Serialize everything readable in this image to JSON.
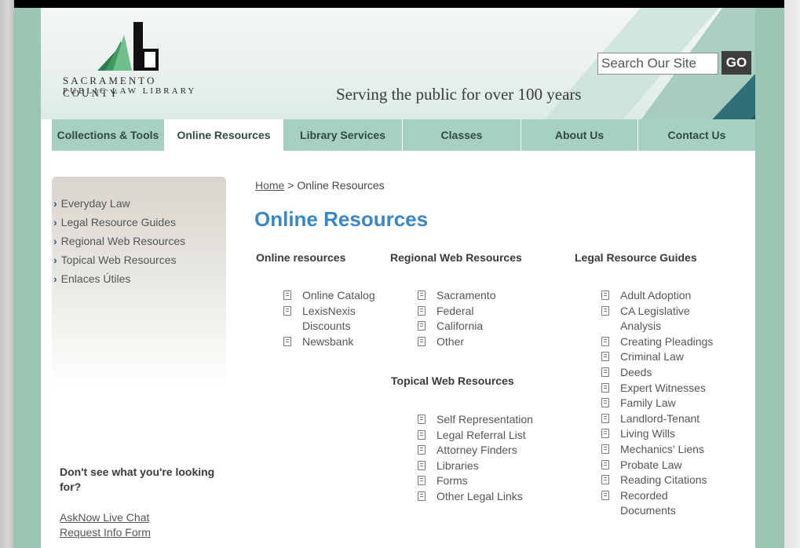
{
  "header": {
    "logo_line1": "SACRAMENTO COUNTY",
    "logo_line2": "PUBLIC LAW LIBRARY",
    "tagline": "Serving the public for over 100 years",
    "search_placeholder": "Search Our Site",
    "go_label": "GO"
  },
  "nav": {
    "tabs": [
      {
        "label": "Collections & Tools"
      },
      {
        "label": "Online Resources"
      },
      {
        "label": "Library Services"
      },
      {
        "label": "Classes"
      },
      {
        "label": "About Us"
      },
      {
        "label": "Contact Us"
      }
    ],
    "active_index": 1
  },
  "sidebar": {
    "items": [
      {
        "label": "Everyday Law"
      },
      {
        "label": "Legal Resource Guides"
      },
      {
        "label": "Regional Web Resources"
      },
      {
        "label": "Topical Web Resources"
      },
      {
        "label": "Enlaces Útiles"
      }
    ],
    "help_heading": "Don't see what you're looking for?",
    "help_links": [
      "AskNow Live Chat",
      "Request Info Form"
    ]
  },
  "breadcrumb": {
    "home": "Home",
    "separator": ">",
    "current": "Online Resources"
  },
  "page_title": "Online Resources",
  "columns": {
    "online": {
      "heading": "Online resources",
      "items": [
        "Online Catalog",
        "LexisNexis Discounts",
        "Newsbank"
      ]
    },
    "regional": {
      "heading": "Regional Web Resources",
      "items": [
        "Sacramento",
        "Federal",
        "California",
        "Other"
      ]
    },
    "topical": {
      "heading": "Topical Web Resources",
      "items": [
        "Self Representation",
        "Legal Referral List",
        "Attorney Finders",
        "Libraries",
        "Forms",
        "Other Legal Links"
      ]
    },
    "guides": {
      "heading": "Legal Resource Guides",
      "items": [
        "Adult Adoption",
        "CA Legislative Analysis",
        "Creating Pleadings",
        "Criminal Law",
        "Deeds",
        "Expert Witnesses",
        "Family Law",
        "Landlord-Tenant",
        "Living Wills",
        "Mechanics' Liens",
        "Probate Law",
        "Reading Citations",
        "Recorded Documents"
      ]
    }
  },
  "colors": {
    "frame": "#9cc6b4",
    "nav_tab": "#a8d0c1",
    "title_blue": "#3a87c4",
    "sidebar_arrow": "#2c5d8a",
    "header_teal": "#2e6f78"
  },
  "icons": {
    "list_bullet": "document-icon",
    "sidebar_bullet": "chevron-right-icon"
  }
}
